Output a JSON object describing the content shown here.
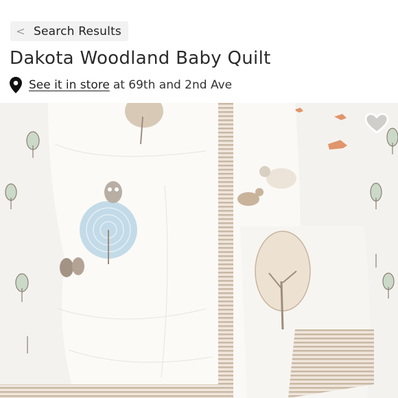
{
  "nav": {
    "back_chevron": "<",
    "back_label": "Search Results"
  },
  "listing": {
    "title": "Dakota Woodland Baby Quilt",
    "store_link_label": "See it in store",
    "store_location": "at 69th and 2nd Ave"
  },
  "icons": {
    "back": "chevron-left-icon",
    "location": "map-pin-icon",
    "like": "heart-outline-icon"
  },
  "colors": {
    "pill_bg": "#f2f2f2",
    "text": "#222222",
    "quilt_stripe": "#c9b8a3",
    "quilt_blue": "#bcd7e6"
  }
}
